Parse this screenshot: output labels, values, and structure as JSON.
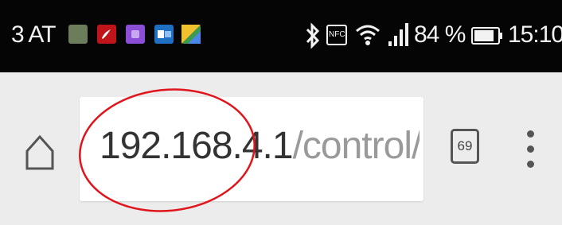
{
  "status_bar": {
    "carrier": "3 AT",
    "battery_percent": "84 %",
    "time": "15:10",
    "nfc_label": "NFC",
    "notification_icons": [
      "photo-icon",
      "pdf-icon",
      "purple-app-icon",
      "outlook-icon",
      "maps-icon"
    ]
  },
  "toolbar": {
    "url_host": "192.168.4.1",
    "url_path": "/control/Bedien",
    "tab_count": "69"
  },
  "colors": {
    "status_bar_bg": "#050505",
    "toolbar_bg": "#ececec",
    "annotation_circle": "#e0141b"
  }
}
